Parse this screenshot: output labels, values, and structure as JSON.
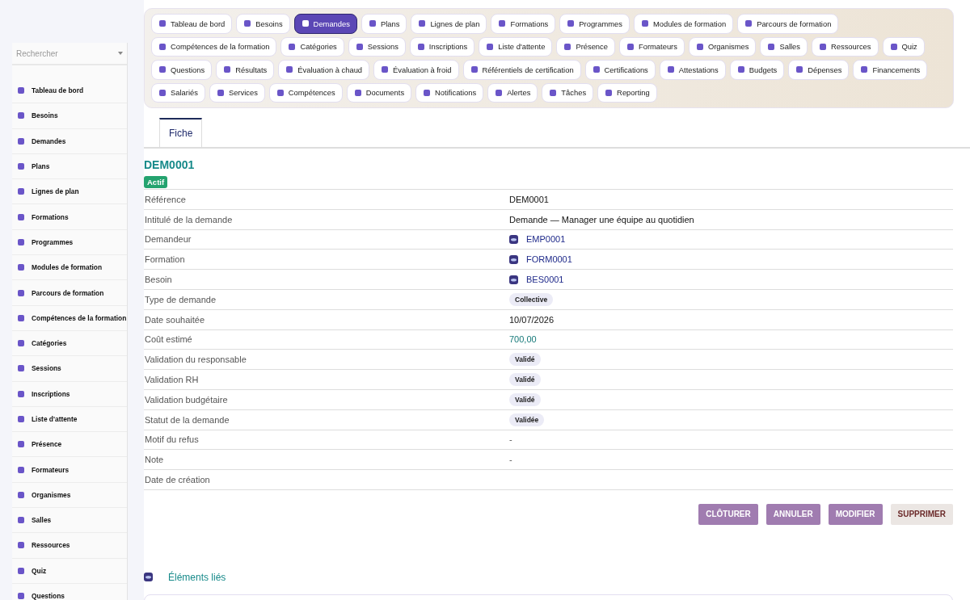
{
  "sidebar": {
    "search": {
      "placeholder": "Rechercher"
    },
    "items": [
      {
        "label": "Tableau de bord",
        "selected": false
      },
      {
        "label": "Besoins",
        "selected": false
      },
      {
        "label": "Demandes",
        "selected": false
      },
      {
        "label": "Plans",
        "selected": false
      },
      {
        "label": "Lignes de plan",
        "selected": false
      },
      {
        "label": "Formations",
        "selected": false
      },
      {
        "label": "Programmes",
        "selected": false
      },
      {
        "label": "Modules de formation",
        "selected": false
      },
      {
        "label": "Parcours de formation",
        "selected": false
      },
      {
        "label": "Compétences de la formation",
        "selected": false
      },
      {
        "label": "Catégories",
        "selected": false
      },
      {
        "label": "Sessions",
        "selected": false
      },
      {
        "label": "Inscriptions",
        "selected": false
      },
      {
        "label": "Liste d'attente",
        "selected": false
      },
      {
        "label": "Présence",
        "selected": false
      },
      {
        "label": "Formateurs",
        "selected": false
      },
      {
        "label": "Organismes",
        "selected": false
      },
      {
        "label": "Salles",
        "selected": false
      },
      {
        "label": "Ressources",
        "selected": false
      },
      {
        "label": "Quiz",
        "selected": false
      },
      {
        "label": "Questions",
        "selected": false
      }
    ]
  },
  "nav_tabs": [
    {
      "label": "Tableau de bord",
      "selected": false
    },
    {
      "label": "Besoins",
      "selected": false
    },
    {
      "label": "Demandes",
      "selected": true
    },
    {
      "label": "Plans",
      "selected": false
    },
    {
      "label": "Lignes de plan",
      "selected": false
    },
    {
      "label": "Formations",
      "selected": false
    },
    {
      "label": "Programmes",
      "selected": false
    },
    {
      "label": "Modules de formation",
      "selected": false
    },
    {
      "label": "Parcours de formation",
      "selected": false
    },
    {
      "label": "Compétences de la formation",
      "selected": false
    },
    {
      "label": "Catégories",
      "selected": false
    },
    {
      "label": "Sessions",
      "selected": false
    },
    {
      "label": "Inscriptions",
      "selected": false
    },
    {
      "label": "Liste d'attente",
      "selected": false
    },
    {
      "label": "Présence",
      "selected": false
    },
    {
      "label": "Formateurs",
      "selected": false
    },
    {
      "label": "Organismes",
      "selected": false
    },
    {
      "label": "Salles",
      "selected": false
    },
    {
      "label": "Ressources",
      "selected": false
    },
    {
      "label": "Quiz",
      "selected": false
    },
    {
      "label": "Questions",
      "selected": false
    },
    {
      "label": "Résultats",
      "selected": false
    },
    {
      "label": "Évaluation à chaud",
      "selected": false
    },
    {
      "label": "Évaluation à froid",
      "selected": false
    },
    {
      "label": "Référentiels de certification",
      "selected": false
    },
    {
      "label": "Certifications",
      "selected": false
    },
    {
      "label": "Attestations",
      "selected": false
    },
    {
      "label": "Budgets",
      "selected": false
    },
    {
      "label": "Dépenses",
      "selected": false
    },
    {
      "label": "Financements",
      "selected": false
    },
    {
      "label": "Salariés",
      "selected": false
    },
    {
      "label": "Services",
      "selected": false
    },
    {
      "label": "Compétences",
      "selected": false
    },
    {
      "label": "Documents",
      "selected": false
    },
    {
      "label": "Notifications",
      "selected": false
    },
    {
      "label": "Alertes",
      "selected": false
    },
    {
      "label": "Tâches",
      "selected": false
    },
    {
      "label": "Reporting",
      "selected": false
    }
  ],
  "record_tabs": [
    {
      "label": "Fiche",
      "selected": true
    }
  ],
  "record": {
    "title": "DEM0001",
    "status": "Actif",
    "fields": [
      {
        "label": "Référence",
        "kind": "text",
        "value": "DEM0001"
      },
      {
        "label": "Intitulé de la demande",
        "kind": "text",
        "value": "Demande — Manager une équipe au quotidien"
      },
      {
        "label": "Demandeur",
        "kind": "link",
        "value": "EMP0001"
      },
      {
        "label": "Formation",
        "kind": "link",
        "value": "FORM0001"
      },
      {
        "label": "Besoin",
        "kind": "link",
        "value": "BES0001"
      },
      {
        "label": "Type de demande",
        "kind": "badge",
        "value": "Collective"
      },
      {
        "label": "Date souhaitée",
        "kind": "text",
        "value": "10/07/2026"
      },
      {
        "label": "Coût estimé",
        "kind": "amount",
        "value": "700,00"
      },
      {
        "label": "Validation du responsable",
        "kind": "badge",
        "value": "Validé"
      },
      {
        "label": "Validation RH",
        "kind": "badge",
        "value": "Validé"
      },
      {
        "label": "Validation budgétaire",
        "kind": "badge",
        "value": "Validé"
      },
      {
        "label": "Statut de la demande",
        "kind": "badge",
        "value": "Validée"
      },
      {
        "label": "Motif du refus",
        "kind": "empty",
        "value": "-"
      },
      {
        "label": "Note",
        "kind": "empty",
        "value": "-"
      },
      {
        "label": "Date de création",
        "kind": "empty"
      }
    ],
    "actions": [
      {
        "label": "CLÔTURER",
        "kind": "primary"
      },
      {
        "label": "ANNULER",
        "kind": "primary"
      },
      {
        "label": "MODIFIER",
        "kind": "primary"
      },
      {
        "label": "SUPPRIMER",
        "kind": "danger"
      }
    ]
  },
  "related": {
    "title": "Éléments liés"
  }
}
